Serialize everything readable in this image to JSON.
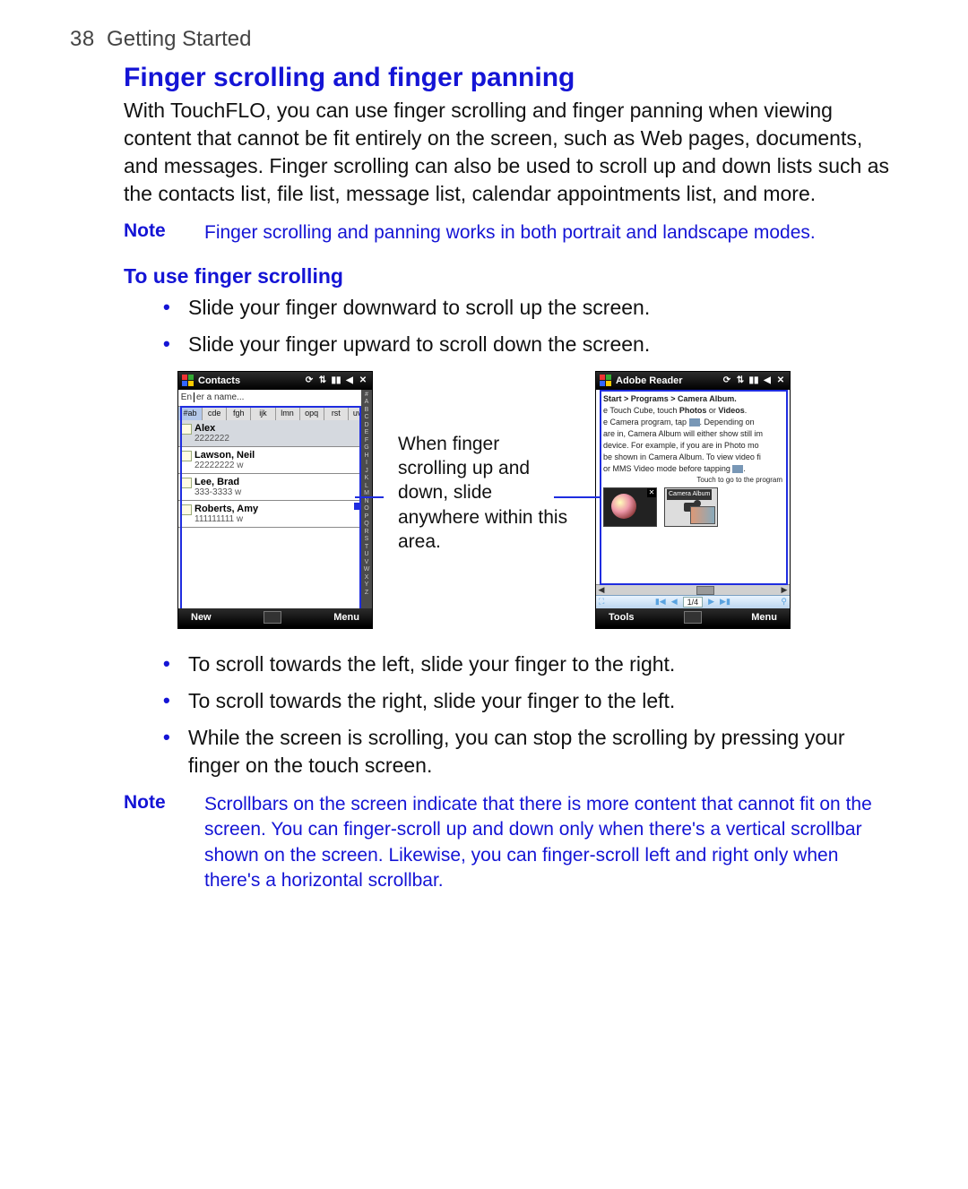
{
  "page": {
    "number": "38",
    "chapter": "Getting Started"
  },
  "title": "Finger scrolling and finger panning",
  "intro": "With TouchFLO, you can use finger scrolling and finger panning when viewing content that cannot be fit entirely on the screen, such as Web pages, documents, and messages. Finger scrolling can also be used to scroll up and down lists such as the contacts list, file list, message list, calendar appointments list, and more.",
  "note1": {
    "label": "Note",
    "text": "Finger scrolling and panning works in both portrait and landscape modes."
  },
  "subheading": "To use finger scrolling",
  "bullets1": [
    "Slide your finger downward to scroll up the screen.",
    "Slide your finger upward to scroll down the screen."
  ],
  "caption": "When finger scrolling up and down, slide anywhere within this area.",
  "contacts": {
    "title": "Contacts",
    "placeholder": "er a name...",
    "placeholder_prefix": "En",
    "tabs": [
      "#ab",
      "cde",
      "fgh",
      "ijk",
      "lmn",
      "opq",
      "rst",
      "uvw"
    ],
    "az": "# A B C D E F G H I J K L M N O P Q R S T U V W X Y Z",
    "list": [
      {
        "name": "Alex",
        "num": "2222222"
      },
      {
        "name": "Lawson, Neil",
        "num": "22222222   w"
      },
      {
        "name": "Lee, Brad",
        "num": "333-3333   w"
      },
      {
        "name": "Roberts, Amy",
        "num": "111111111   w"
      }
    ],
    "sk_left": "New",
    "sk_right": "Menu"
  },
  "reader": {
    "title": "Adobe Reader",
    "breadcrumb_prefix": "Start",
    "breadcrumb": " > Programs > Camera Album.",
    "line2a": "e Touch Cube, touch ",
    "line2b": "Photos",
    "line2c": " or ",
    "line2d": "Videos",
    "line2e": ".",
    "line3a": "e Camera program, tap ",
    "line3b": ". Depending on",
    "line4": "are in, Camera Album will either show still im",
    "line5": "device. For example, if you are in Photo mo",
    "line6": "be shown in Camera Album. To view video fi",
    "line7a": "or MMS Video",
    "line7b": " mode before tapping ",
    "callout": "Touch to go to the program",
    "thumb2_label": "Camera Album",
    "page_indicator": "1/4",
    "sk_left": "Tools",
    "sk_right": "Menu"
  },
  "bullets2": [
    "To scroll towards the left, slide your finger to the right.",
    "To scroll towards the right, slide your finger to the left.",
    "While the screen is scrolling, you can stop the scrolling by pressing your finger on the touch screen."
  ],
  "note2": {
    "label": "Note",
    "text": "Scrollbars on the screen indicate that there is more content that cannot fit on the screen. You can finger-scroll up and down only when there's a vertical scrollbar shown on the screen. Likewise, you can finger-scroll left and right only when there's a horizontal scrollbar."
  }
}
